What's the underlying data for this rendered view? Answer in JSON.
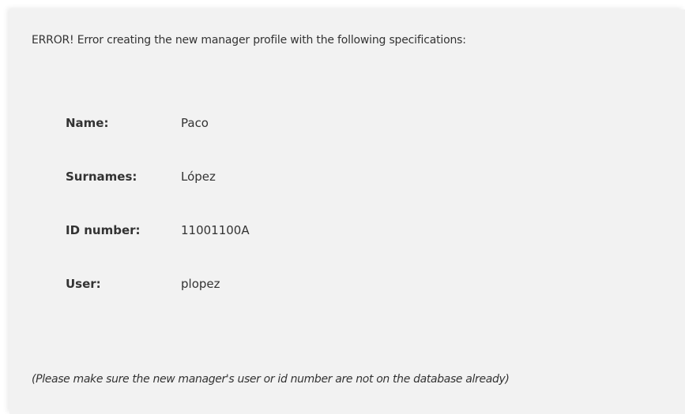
{
  "message": {
    "title": "ERROR! Error creating the new manager profile with the following specifications:",
    "fields": [
      {
        "label": "Name:",
        "value": "Paco"
      },
      {
        "label": "Surnames:",
        "value": "López"
      },
      {
        "label": "ID number:",
        "value": "11001100A"
      },
      {
        "label": "User:",
        "value": "plopez"
      }
    ],
    "note": "(Please make sure the new manager's user or id number are not on the database already)"
  }
}
